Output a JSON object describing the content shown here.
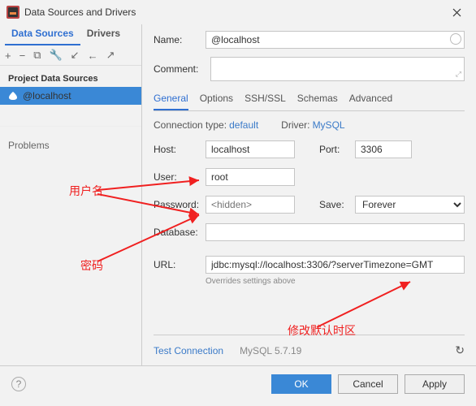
{
  "window": {
    "title": "Data Sources and Drivers"
  },
  "sidebar": {
    "tabs": [
      "Data Sources",
      "Drivers"
    ],
    "section": "Project Data Sources",
    "item": "@localhost",
    "problems": "Problems"
  },
  "form": {
    "name_label": "Name:",
    "name_value": "@localhost",
    "comment_label": "Comment:"
  },
  "tabs": [
    "General",
    "Options",
    "SSH/SSL",
    "Schemas",
    "Advanced"
  ],
  "conn": {
    "type_label": "Connection type:",
    "type_value": "default",
    "driver_label": "Driver:",
    "driver_value": "MySQL"
  },
  "fields": {
    "host_label": "Host:",
    "host_value": "localhost",
    "port_label": "Port:",
    "port_value": "3306",
    "user_label": "User:",
    "user_value": "root",
    "password_label": "Password:",
    "password_placeholder": "<hidden>",
    "save_label": "Save:",
    "save_value": "Forever",
    "database_label": "Database:",
    "database_value": "",
    "url_label": "URL:",
    "url_value": "jdbc:mysql://localhost:3306/?serverTimezone=GMT",
    "override": "Overrides settings above"
  },
  "bottom": {
    "test": "Test Connection",
    "version": "MySQL 5.7.19"
  },
  "buttons": {
    "ok": "OK",
    "cancel": "Cancel",
    "apply": "Apply"
  },
  "annotations": {
    "user": "用户名",
    "pwd": "密码",
    "tz": "修改默认时区"
  }
}
